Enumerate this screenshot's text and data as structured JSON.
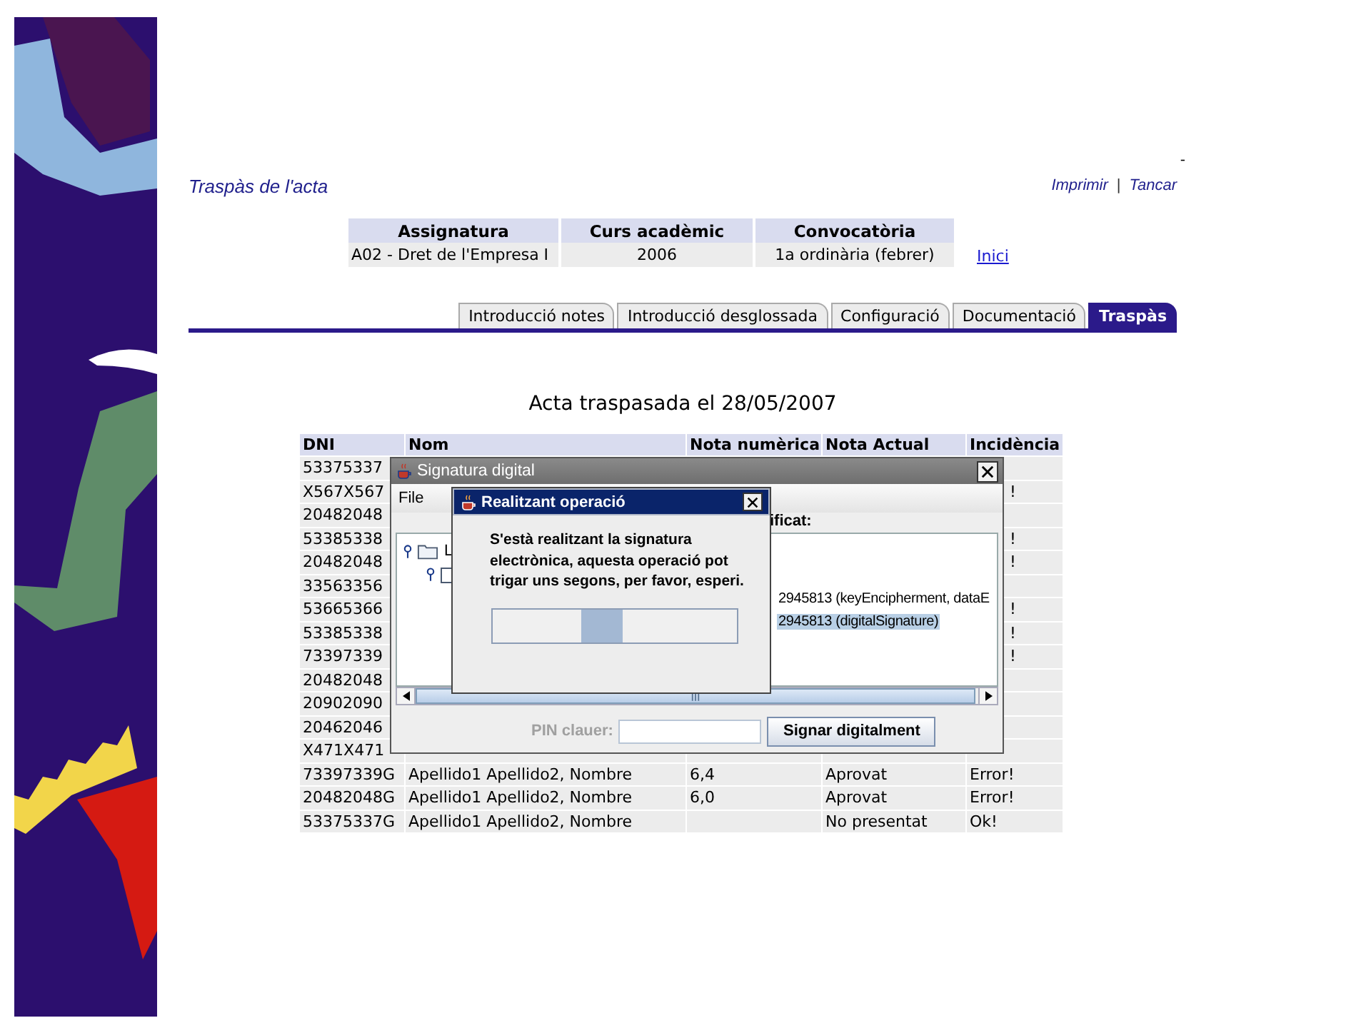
{
  "corner_mark": "-",
  "page_title": "Traspàs de l'acta",
  "links": [
    "Imprimir",
    "Tancar"
  ],
  "link_separator": "|",
  "summary": {
    "columns": [
      "Assignatura",
      "Curs acadèmic",
      "Convocatòria"
    ],
    "values": [
      "A02 - Dret de l'Empresa I",
      "2006",
      "1a ordinària (febrer)"
    ],
    "link": "Inici"
  },
  "tabs": [
    {
      "label": "Introducció notes",
      "selected": false
    },
    {
      "label": "Introducció desglossada",
      "selected": false
    },
    {
      "label": "Configuració",
      "selected": false
    },
    {
      "label": "Documentació",
      "selected": false
    },
    {
      "label": "Traspàs",
      "selected": true
    }
  ],
  "heading": "Acta traspasada el 28/05/2007",
  "table": {
    "columns": [
      "DNI",
      "Nom",
      "Nota numèrica",
      "Nota Actual",
      "Incidència"
    ],
    "rows": [
      {
        "dni": "53375337"
      },
      {
        "dni": "X567X567",
        "incidencia": "!"
      },
      {
        "dni": "20482048"
      },
      {
        "dni": "53385338",
        "incidencia": "!"
      },
      {
        "dni": "20482048",
        "incidencia": "!"
      },
      {
        "dni": "33563356"
      },
      {
        "dni": "53665366",
        "incidencia": "!"
      },
      {
        "dni": "53385338",
        "incidencia": "!"
      },
      {
        "dni": "73397339",
        "incidencia": "!"
      },
      {
        "dni": "20482048"
      },
      {
        "dni": "20902090"
      },
      {
        "dni": "20462046"
      },
      {
        "dni": "X471X471"
      },
      {
        "dni": "73397339G",
        "nom": "Apellido1 Apellido2, Nombre",
        "nota": "6,4",
        "actual": "Aprovat",
        "incidencia": "Error!"
      },
      {
        "dni": "20482048G",
        "nom": "Apellido1 Apellido2, Nombre",
        "nota": "6,0",
        "actual": "Aprovat",
        "incidencia": "Error!"
      },
      {
        "dni": "53375337G",
        "nom": "Apellido1 Apellido2, Nombre",
        "actual": "No presentat",
        "incidencia": "Ok!"
      }
    ]
  },
  "signature_dialog": {
    "title": "Signatura digital",
    "menu": [
      "File"
    ],
    "pane_label": "ificat:",
    "tree_rows": [
      {
        "kind": "folder",
        "label": "L",
        "selected": false
      },
      {
        "kind": "leaf",
        "selected": false
      },
      {
        "kind": "text",
        "label": "2945813 (keyEncipherment, dataE",
        "selected": false
      },
      {
        "kind": "text",
        "label": "2945813 (digitalSignature)",
        "selected": true
      }
    ],
    "pin": {
      "label": "PIN clauer:",
      "disabled": true
    },
    "button": "Signar digitalment"
  },
  "progress_dialog": {
    "indeterminate": true,
    "title": "Realitzant operació",
    "message": "S'està realitzant la signatura electrònica, aquesta operació pot trigar uns segons, per favor, esperi."
  }
}
